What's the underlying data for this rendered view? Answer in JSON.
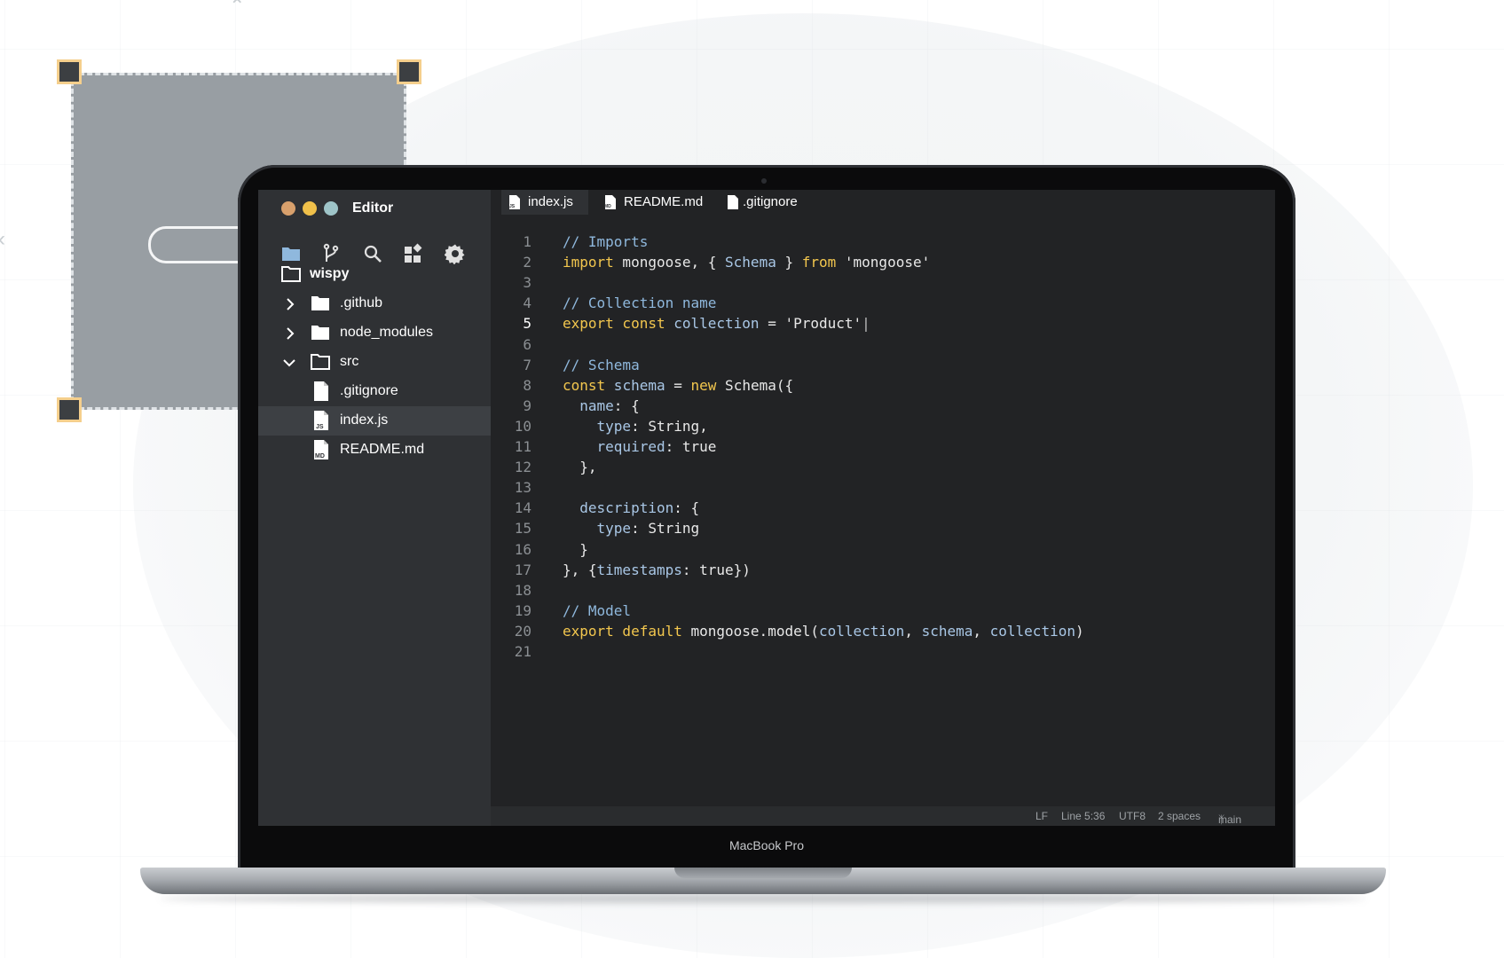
{
  "app": {
    "title": "Editor"
  },
  "device": {
    "label": "MacBook Pro"
  },
  "traffic_lights": {
    "colors": [
      "#d8a06c",
      "#f0c04a",
      "#9ec4c8"
    ]
  },
  "toolbar": {
    "icons": [
      "folder-icon",
      "git-branch-icon",
      "search-icon",
      "extensions-icon",
      "gear-icon"
    ]
  },
  "explorer": {
    "root": "wispy",
    "items": [
      {
        "label": ".github",
        "type": "folder",
        "expanded": false
      },
      {
        "label": "node_modules",
        "type": "folder",
        "expanded": false
      },
      {
        "label": "src",
        "type": "folder",
        "expanded": true
      },
      {
        "label": ".gitignore",
        "type": "file"
      },
      {
        "label": "index.js",
        "type": "file",
        "badge": "JS",
        "selected": true
      },
      {
        "label": "README.md",
        "type": "file",
        "badge": "MD"
      }
    ]
  },
  "tabs": [
    {
      "label": "index.js",
      "badge": "JS",
      "active": true
    },
    {
      "label": "README.md",
      "badge": "MD",
      "active": false
    },
    {
      "label": ".gitignore",
      "badge": "",
      "active": false
    }
  ],
  "editor": {
    "current_line": 5,
    "lines": [
      {
        "n": "1",
        "tokens": [
          [
            "cm",
            "// Imports"
          ]
        ]
      },
      {
        "n": "2",
        "tokens": [
          [
            "kw",
            "import"
          ],
          [
            "pl",
            " mongoose, { "
          ],
          [
            "id",
            "Schema"
          ],
          [
            "pl",
            " } "
          ],
          [
            "kw",
            "from"
          ],
          [
            "str",
            " 'mongoose'"
          ]
        ]
      },
      {
        "n": "3",
        "tokens": []
      },
      {
        "n": "4",
        "tokens": [
          [
            "cm",
            "// Collection name"
          ]
        ]
      },
      {
        "n": "5",
        "tokens": [
          [
            "kw",
            "export const"
          ],
          [
            "id",
            " collection"
          ],
          [
            "pl",
            " = "
          ],
          [
            "str",
            "'Product'"
          ],
          [
            "cursor",
            "|"
          ]
        ]
      },
      {
        "n": "6",
        "tokens": []
      },
      {
        "n": "7",
        "tokens": [
          [
            "cm",
            "// Schema"
          ]
        ]
      },
      {
        "n": "8",
        "tokens": [
          [
            "kw",
            "const"
          ],
          [
            "id",
            " schema"
          ],
          [
            "pl",
            " = "
          ],
          [
            "kw",
            "new"
          ],
          [
            "pl",
            " Schema({"
          ]
        ]
      },
      {
        "n": "9",
        "tokens": [
          [
            "id",
            "  name"
          ],
          [
            "pl",
            ": {"
          ]
        ]
      },
      {
        "n": "10",
        "tokens": [
          [
            "id",
            "    type"
          ],
          [
            "pl",
            ": String,"
          ]
        ]
      },
      {
        "n": "11",
        "tokens": [
          [
            "id",
            "    required"
          ],
          [
            "pl",
            ": true"
          ]
        ]
      },
      {
        "n": "12",
        "tokens": [
          [
            "pl",
            "  },"
          ]
        ]
      },
      {
        "n": "13",
        "tokens": []
      },
      {
        "n": "14",
        "tokens": [
          [
            "id",
            "  description"
          ],
          [
            "pl",
            ": {"
          ]
        ]
      },
      {
        "n": "15",
        "tokens": [
          [
            "id",
            "    type"
          ],
          [
            "pl",
            ": String"
          ]
        ]
      },
      {
        "n": "16",
        "tokens": [
          [
            "pl",
            "  }"
          ]
        ]
      },
      {
        "n": "17",
        "tokens": [
          [
            "pl",
            "}, {"
          ],
          [
            "id",
            "timestamps"
          ],
          [
            "pl",
            ": true})"
          ]
        ]
      },
      {
        "n": "18",
        "tokens": []
      },
      {
        "n": "19",
        "tokens": [
          [
            "cm",
            "// Model"
          ]
        ]
      },
      {
        "n": "20",
        "tokens": [
          [
            "kw",
            "export default"
          ],
          [
            "pl",
            " mongoose.model("
          ],
          [
            "id",
            "collection"
          ],
          [
            "pl",
            ", "
          ],
          [
            "id",
            "schema"
          ],
          [
            "pl",
            ", "
          ],
          [
            "id",
            "collection"
          ],
          [
            "pl",
            ")"
          ]
        ]
      },
      {
        "n": "21",
        "tokens": []
      }
    ]
  },
  "status": {
    "eol": "LF",
    "position": "Line 5:36",
    "encoding": "UTF8",
    "indent": "2 spaces",
    "branch": "main"
  }
}
